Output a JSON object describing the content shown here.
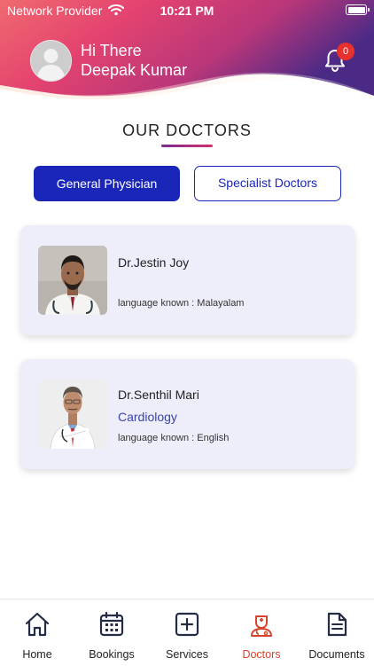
{
  "status_bar": {
    "carrier": "Network Provider",
    "time": "10:21 PM"
  },
  "header": {
    "greeting": "Hi There",
    "user_name": "Deepak Kumar",
    "notification_count": "0"
  },
  "section": {
    "title": "OUR DOCTORS"
  },
  "tabs": [
    {
      "label": "General Physician",
      "selected": true
    },
    {
      "label": "Specialist Doctors",
      "selected": false
    }
  ],
  "doctors": [
    {
      "name": "Dr.Jestin  Joy",
      "specialty": "",
      "language": "language known : Malayalam"
    },
    {
      "name": "Dr.Senthil Mari",
      "specialty": "Cardiology",
      "language": "language known : English"
    }
  ],
  "bottom_nav": [
    {
      "label": "Home",
      "icon": "home-icon",
      "active": false
    },
    {
      "label": "Bookings",
      "icon": "calendar-icon",
      "active": false
    },
    {
      "label": "Services",
      "icon": "plus-square-icon",
      "active": false
    },
    {
      "label": "Doctors",
      "icon": "doctor-icon",
      "active": true
    },
    {
      "label": "Documents",
      "icon": "document-icon",
      "active": false
    }
  ],
  "colors": {
    "primary_blue": "#1a26b8",
    "active_nav": "#d8432b",
    "card_bg": "#eeeefb",
    "badge": "#e8312c"
  }
}
